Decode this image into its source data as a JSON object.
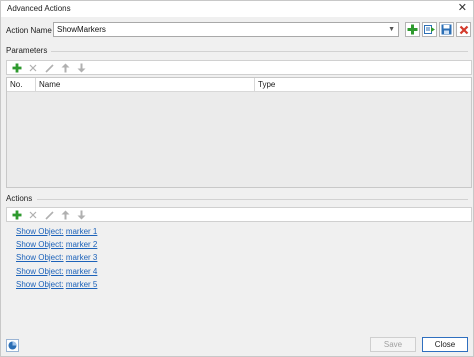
{
  "window": {
    "title": "Advanced Actions",
    "close_glyph": "✕"
  },
  "action_name": {
    "label": "Action Name",
    "value": "ShowMarkers",
    "toolbar_icons": [
      "add-icon",
      "import-icon",
      "save-icon",
      "delete-icon"
    ]
  },
  "parameters": {
    "label": "Parameters",
    "toolbar_icons": [
      "add-icon",
      "remove-icon",
      "edit-icon",
      "move-up-icon",
      "move-down-icon"
    ],
    "columns": [
      "No.",
      "Name",
      "Type"
    ]
  },
  "actions": {
    "label": "Actions",
    "toolbar_icons": [
      "add-icon",
      "remove-icon",
      "edit-icon",
      "move-up-icon",
      "move-down-icon"
    ],
    "items": [
      {
        "command": "Show Object:",
        "target": "marker 1"
      },
      {
        "command": "Show Object:",
        "target": "marker 2"
      },
      {
        "command": "Show Object:",
        "target": "marker 3"
      },
      {
        "command": "Show Object:",
        "target": "marker 4"
      },
      {
        "command": "Show Object:",
        "target": "marker 5"
      }
    ]
  },
  "footer": {
    "save_label": "Save",
    "close_label": "Close",
    "help_icon": "info-icon"
  },
  "colors": {
    "add_green": "#2e9a2e",
    "delete_red": "#d33a2c",
    "link_blue": "#1c62b9",
    "icon_blue": "#2c6fb5",
    "disabled_gray": "#b0b0b0"
  }
}
